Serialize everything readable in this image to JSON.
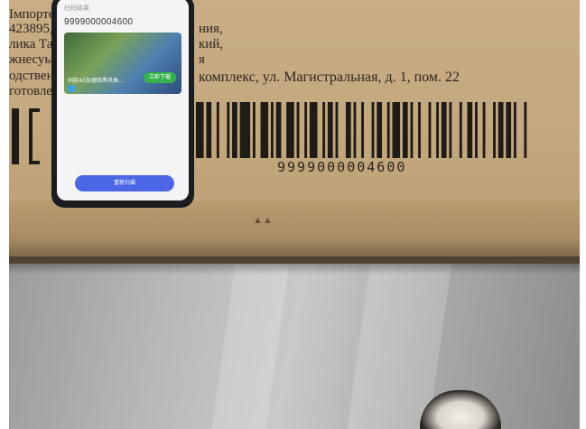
{
  "label_lines": [
    "Імпортер: ООО",
    "423895,",
    "лика Тат",
    "жнесуы",
    "одствен",
    "готовле"
  ],
  "label_right_1": "ния,",
  "label_right_2": "кий,",
  "label_right_3": "я",
  "address_line": "комплекс, ул. Магистральная, д. 1, пом. 22",
  "barcode_number": "9999000004600",
  "phone_screen": {
    "field_label": "扫码结果",
    "field_value": "9999000004600",
    "video_caption": "同款4G加速暗黑风格...",
    "video_button": "立即下载",
    "main_button": "重新扫描"
  }
}
